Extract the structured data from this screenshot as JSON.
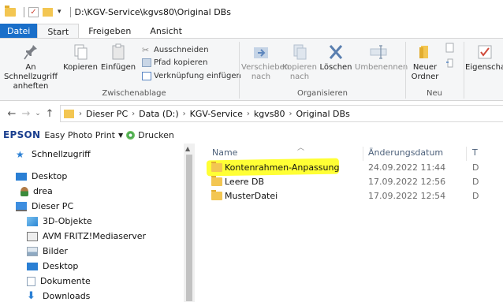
{
  "window": {
    "title": "D:\\KGV-Service\\kgvs80\\Original DBs"
  },
  "tabs": [
    {
      "label": "Datei"
    },
    {
      "label": "Start"
    },
    {
      "label": "Freigeben"
    },
    {
      "label": "Ansicht"
    }
  ],
  "ribbon": {
    "pin_label_1": "An Schnellzugriff",
    "pin_label_2": "anheften",
    "copy_label": "Kopieren",
    "paste_label": "Einfügen",
    "cut_label": "Ausschneiden",
    "copy_path_label": "Pfad kopieren",
    "paste_shortcut_label": "Verknüpfung einfügen",
    "group_clipboard": "Zwischenablage",
    "move_to_label_1": "Verschieben",
    "move_to_label_2": "nach",
    "copy_to_label_1": "Kopieren",
    "copy_to_label_2": "nach",
    "delete_label": "Löschen",
    "rename_label": "Umbenennen",
    "group_organize": "Organisieren",
    "new_folder_label_1": "Neuer",
    "new_folder_label_2": "Ordner",
    "group_new": "Neu",
    "properties_label": "Eigenschaften"
  },
  "address": {
    "crumbs": [
      "Dieser PC",
      "Data (D:)",
      "KGV-Service",
      "kgvs80",
      "Original DBs"
    ]
  },
  "epson": {
    "logo": "EPSON",
    "app": "Easy Photo Print",
    "print": "Drucken"
  },
  "nav": {
    "items": [
      {
        "label": "Schnellzugriff",
        "icon": "star-icon"
      },
      {
        "label": "Desktop",
        "icon": "desktop-icon"
      },
      {
        "label": "drea",
        "icon": "user-icon"
      },
      {
        "label": "Dieser PC",
        "icon": "pc-icon"
      },
      {
        "label": "3D-Objekte",
        "icon": "3d-objects-icon"
      },
      {
        "label": "AVM FRITZ!Mediaserver",
        "icon": "media-server-icon"
      },
      {
        "label": "Bilder",
        "icon": "pictures-icon"
      },
      {
        "label": "Desktop",
        "icon": "desktop-icon"
      },
      {
        "label": "Dokumente",
        "icon": "documents-icon"
      },
      {
        "label": "Downloads",
        "icon": "downloads-icon"
      }
    ]
  },
  "content": {
    "columns": {
      "name": "Name",
      "date": "Änderungsdatum",
      "type": "T"
    },
    "rows": [
      {
        "name": "Kontenrahmen-Anpassung",
        "date": "24.09.2022 11:44",
        "type": "D"
      },
      {
        "name": "Leere DB",
        "date": "17.09.2022 12:56",
        "type": "D"
      },
      {
        "name": "MusterDatei",
        "date": "17.09.2022 12:54",
        "type": "D"
      }
    ]
  },
  "colors": {
    "file_tab": "#1a6fc9",
    "folder": "#f3c652",
    "highlight": "#ffff35",
    "epson": "#1b3f8f"
  }
}
